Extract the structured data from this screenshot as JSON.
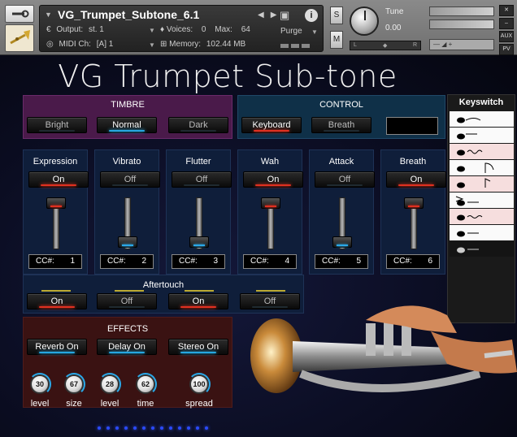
{
  "header": {
    "instrument_name": "VG_Trumpet_Subtone_6.1",
    "output_label": "Output:",
    "output_value": "st. 1",
    "voices_label": "Voices:",
    "voices_value": "0",
    "max_label": "Max:",
    "max_value": "64",
    "purge_label": "Purge",
    "midi_label": "MIDI Ch:",
    "midi_value": "[A]  1",
    "memory_label": "Memory:",
    "memory_value": "102.44 MB",
    "solo_label": "S",
    "mute_label": "M",
    "tune_label": "Tune",
    "tune_value": "0.00",
    "pan_left": "L",
    "pan_right": "R",
    "aux_label": "AUX",
    "pv_label": "PV"
  },
  "title": "VG Trumpet Sub-tone",
  "timbre": {
    "heading": "TIMBRE",
    "buttons": [
      "Bright",
      "Normal",
      "Dark"
    ],
    "selected": "Normal"
  },
  "control": {
    "heading": "CONTROL",
    "buttons": [
      "Keyboard",
      "Breath"
    ],
    "selected": "Keyboard"
  },
  "keyswitch": {
    "heading": "Keyswitch",
    "count": 9
  },
  "sliders": [
    {
      "label": "Expression",
      "toggle": "On",
      "cc_label": "CC#:",
      "cc": "1",
      "level": 0.95
    },
    {
      "label": "Vibrato",
      "toggle": "Off",
      "cc_label": "CC#:",
      "cc": "2",
      "level": 0.1
    },
    {
      "label": "Flutter",
      "toggle": "Off",
      "cc_label": "CC#:",
      "cc": "3",
      "level": 0.1
    },
    {
      "label": "Wah",
      "toggle": "On",
      "cc_label": "CC#:",
      "cc": "4",
      "level": 0.95
    },
    {
      "label": "Attack",
      "toggle": "Off",
      "cc_label": "CC#:",
      "cc": "5",
      "level": 0.1
    },
    {
      "label": "Breath",
      "toggle": "On",
      "cc_label": "CC#:",
      "cc": "6",
      "level": 0.95
    }
  ],
  "aftertouch": {
    "heading": "Aftertouch",
    "buttons": [
      "On",
      "Off",
      "On",
      "Off"
    ]
  },
  "effects": {
    "heading": "EFFECTS",
    "buttons": [
      "Reverb On",
      "Delay On",
      "Stereo On"
    ],
    "knobs": [
      {
        "label": "level",
        "value": "30"
      },
      {
        "label": "size",
        "value": "67"
      },
      {
        "label": "level",
        "value": "28"
      },
      {
        "label": "time",
        "value": "62"
      },
      {
        "label": "spread",
        "value": "100"
      }
    ]
  },
  "colors": {
    "timbre_bg": "#4a1a4a",
    "control_bg": "#0f3048",
    "effects_bg": "#3a1212",
    "slot_bg": "#0f1e3a",
    "led_on_blue": "#26a6e0",
    "led_on_red": "#e03020"
  }
}
